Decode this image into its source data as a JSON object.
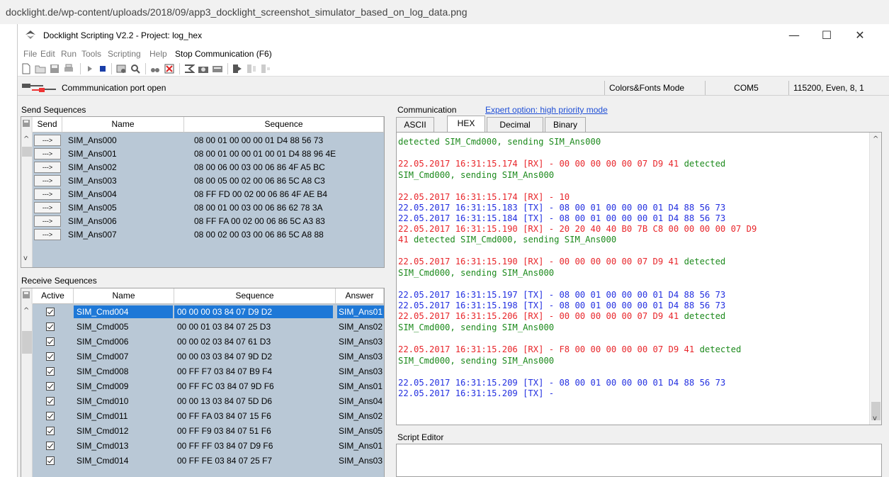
{
  "browser": {
    "url": "docklight.de/wp-content/uploads/2018/09/app3_docklight_screenshot_simulator_based_on_log_data.png"
  },
  "window": {
    "title": "Docklight Scripting V2.2 - Project: log_hex",
    "minimize": "—",
    "maximize": "☐",
    "close": "✕"
  },
  "menu": {
    "file": "File",
    "edit": "Edit",
    "run": "Run",
    "tools": "Tools",
    "scripting": "Scripting",
    "help": "Help",
    "stop": "Stop Communication  (F6)"
  },
  "status": {
    "text": "Commmunication port open",
    "mode": "Colors&Fonts Mode",
    "port": "COM5",
    "settings": "115200, Even, 8, 1"
  },
  "send_sequences": {
    "label": "Send Sequences",
    "headers": {
      "send": "Send",
      "name": "Name",
      "sequence": "Sequence"
    },
    "button_label": "--->",
    "rows": [
      {
        "name": "SIM_Ans000",
        "sequence": "08 00 01 00 00 00 01 D4 88 56 73"
      },
      {
        "name": "SIM_Ans001",
        "sequence": "08 00 01 00 00 01 00 01 D4 88 96 4E"
      },
      {
        "name": "SIM_Ans002",
        "sequence": "08 00 06 00 03 00 06 86 4F A5 BC"
      },
      {
        "name": "SIM_Ans003",
        "sequence": "08 00 05 00 02 00 06 86 5C A8 C3"
      },
      {
        "name": "SIM_Ans004",
        "sequence": "08 FF FD 00 02 00 06 86 4F AE B4"
      },
      {
        "name": "SIM_Ans005",
        "sequence": "08 00 01 00 03 00 06 86 62 78 3A"
      },
      {
        "name": "SIM_Ans006",
        "sequence": "08 FF FA 00 02 00 06 86 5C A3 83"
      },
      {
        "name": "SIM_Ans007",
        "sequence": "08 00 02 00 03 00 06 86 5C A8 88"
      }
    ]
  },
  "receive_sequences": {
    "label": "Receive Sequences",
    "headers": {
      "active": "Active",
      "name": "Name",
      "sequence": "Sequence",
      "answer": "Answer"
    },
    "rows": [
      {
        "name": "SIM_Cmd004",
        "sequence": "00 00 00 03 84 07 D9 D2",
        "answer": "SIM_Ans01"
      },
      {
        "name": "SIM_Cmd005",
        "sequence": "00 00 01 03 84 07 25 D3",
        "answer": "SIM_Ans02"
      },
      {
        "name": "SIM_Cmd006",
        "sequence": "00 00 02 03 84 07 61 D3",
        "answer": "SIM_Ans03"
      },
      {
        "name": "SIM_Cmd007",
        "sequence": "00 00 03 03 84 07 9D D2",
        "answer": "SIM_Ans03"
      },
      {
        "name": "SIM_Cmd008",
        "sequence": "00 FF F7 03 84 07 B9 F4",
        "answer": "SIM_Ans03"
      },
      {
        "name": "SIM_Cmd009",
        "sequence": "00 FF FC 03 84 07 9D F6",
        "answer": "SIM_Ans01"
      },
      {
        "name": "SIM_Cmd010",
        "sequence": "00 00 13 03 84 07 5D D6",
        "answer": "SIM_Ans04"
      },
      {
        "name": "SIM_Cmd011",
        "sequence": "00 FF FA 03 84 07 15 F6",
        "answer": "SIM_Ans02"
      },
      {
        "name": "SIM_Cmd012",
        "sequence": "00 FF F9 03 84 07 51 F6",
        "answer": "SIM_Ans05"
      },
      {
        "name": "SIM_Cmd013",
        "sequence": "00 FF FF 03 84 07 D9 F6",
        "answer": "SIM_Ans01"
      },
      {
        "name": "SIM_Cmd014",
        "sequence": "00 FF FE 03 84 07 25 F7",
        "answer": "SIM_Ans03"
      }
    ]
  },
  "communication": {
    "label": "Communication",
    "expert_link": "Expert option: high priority mode",
    "tabs": [
      "ASCII",
      "HEX",
      "Decimal",
      "Binary"
    ],
    "active_tab": "HEX",
    "lines": [
      {
        "text": "detected SIM_Cmd000, sending SIM_Ans000",
        "parts": [
          {
            "t": "detected SIM_Cmd000, sending SIM_Ans000",
            "c": "green"
          }
        ]
      },
      {
        "parts": [
          {
            "t": "22.05.2017 16:31:15.174 [RX] - 00 00 00 00 00 07 D9 41",
            "c": "red"
          },
          {
            "t": "  detected",
            "c": "green"
          }
        ]
      },
      {
        "parts": [
          {
            "t": "SIM_Cmd000, sending SIM_Ans000",
            "c": "green"
          }
        ]
      },
      {
        "parts": [
          {
            "t": "22.05.2017 16:31:15.174 [RX] - 10",
            "c": "red"
          }
        ]
      },
      {
        "parts": [
          {
            "t": "22.05.2017 16:31:15.183 [TX] - 08 00 01 00 00 00 01 D4 88 56 73",
            "c": "blue"
          }
        ]
      },
      {
        "parts": [
          {
            "t": "22.05.2017 16:31:15.184 [TX] - 08 00 01 00 00 00 01 D4 88 56 73",
            "c": "blue"
          }
        ]
      },
      {
        "parts": [
          {
            "t": "22.05.2017 16:31:15.190 [RX] - 20 20 40 40 B0 7B C8 00 00 00 00 07 D9",
            "c": "red"
          }
        ]
      },
      {
        "parts": [
          {
            "t": "41",
            "c": "red"
          },
          {
            "t": "  detected SIM_Cmd000, sending SIM_Ans000",
            "c": "green"
          }
        ]
      },
      {
        "parts": [
          {
            "t": "22.05.2017 16:31:15.190 [RX] - 00 00 00 00 00 07 D9 41",
            "c": "red"
          },
          {
            "t": "  detected",
            "c": "green"
          }
        ]
      },
      {
        "parts": [
          {
            "t": "SIM_Cmd000, sending SIM_Ans000",
            "c": "green"
          }
        ]
      },
      {
        "parts": [
          {
            "t": "22.05.2017 16:31:15.197 [TX] - 08 00 01 00 00 00 01 D4 88 56 73",
            "c": "blue"
          }
        ]
      },
      {
        "parts": [
          {
            "t": "22.05.2017 16:31:15.198 [TX] - 08 00 01 00 00 00 01 D4 88 56 73",
            "c": "blue"
          }
        ]
      },
      {
        "parts": [
          {
            "t": "22.05.2017 16:31:15.206 [RX] - 00 00 00 00 00 07 D9 41",
            "c": "red"
          },
          {
            "t": "  detected",
            "c": "green"
          }
        ]
      },
      {
        "parts": [
          {
            "t": "SIM_Cmd000, sending SIM_Ans000",
            "c": "green"
          }
        ]
      },
      {
        "parts": [
          {
            "t": "22.05.2017 16:31:15.206 [RX] - F8 00 00 00 00 00 07 D9 41",
            "c": "red"
          },
          {
            "t": "  detected",
            "c": "green"
          }
        ]
      },
      {
        "parts": [
          {
            "t": "SIM_Cmd000, sending SIM_Ans000",
            "c": "green"
          }
        ]
      },
      {
        "parts": [
          {
            "t": "22.05.2017 16:31:15.209 [TX] - 08 00 01 00 00 00 01 D4 88 56 73",
            "c": "blue"
          }
        ]
      },
      {
        "parts": [
          {
            "t": "22.05.2017 16:31:15.209 [TX] -",
            "c": "blue"
          }
        ]
      }
    ]
  },
  "script_editor": {
    "label": "Script Editor"
  },
  "colors": {
    "red": "#e8262b",
    "green": "#1d8a1d",
    "blue": "#2330e0",
    "grid_bg": "#b9c8d6",
    "selection": "#1e78d7",
    "link": "#1f4fd6"
  }
}
